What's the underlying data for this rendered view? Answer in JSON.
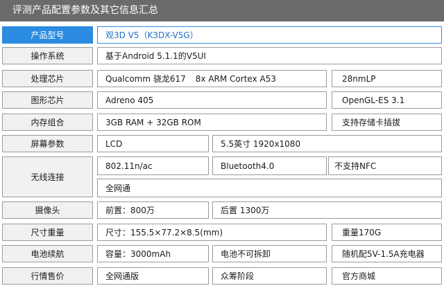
{
  "page_title": "评测产品配置参数及其它信息汇总",
  "colors": {
    "header_bg": "#6b6b6b",
    "accent": "#2b8be0",
    "label_bg": "#f1f1f1",
    "border": "#9a9a9a"
  },
  "rows": {
    "model": {
      "label": "产品型号",
      "value": "观3D V5（K3DX-V5G）"
    },
    "os": {
      "label": "操作系统",
      "value": "基于Android 5.1.1的V5UI"
    },
    "cpu": {
      "label": "处理芯片",
      "chip": "Qualcomm 骁龙617",
      "cores": "8x ARM Cortex A53",
      "process": "28nmLP"
    },
    "gpu": {
      "label": "图形芯片",
      "value": "Adreno 405",
      "api": "OpenGL-ES 3.1"
    },
    "memory": {
      "label": "内存组合",
      "value": "3GB RAM + 32GB ROM",
      "expansion": "支持存储卡插拔"
    },
    "screen": {
      "label": "屏幕参数",
      "type": "LCD",
      "size": "5.5英寸 1920x1080"
    },
    "wireless": {
      "label": "无线连接",
      "wifi": "802.11n/ac",
      "bluetooth": "Bluetooth4.0",
      "nfc": "不支持NFC",
      "network": "全网通"
    },
    "camera": {
      "label": "摄像头",
      "front": "前置：800万",
      "rear": "后置 1300万"
    },
    "dimensions": {
      "label": "尺寸重量",
      "size": "尺寸：155.5×77.2×8.5(mm)",
      "weight": "重量170G"
    },
    "battery": {
      "label": "电池续航",
      "capacity": "容量：3000mAh",
      "removable": "电池不可拆卸",
      "charger": "随机配5V-1.5A充电器"
    },
    "price": {
      "label": "行情售价",
      "version": "全网通版",
      "channel": "众筹阶段",
      "store": "官方商城"
    }
  }
}
